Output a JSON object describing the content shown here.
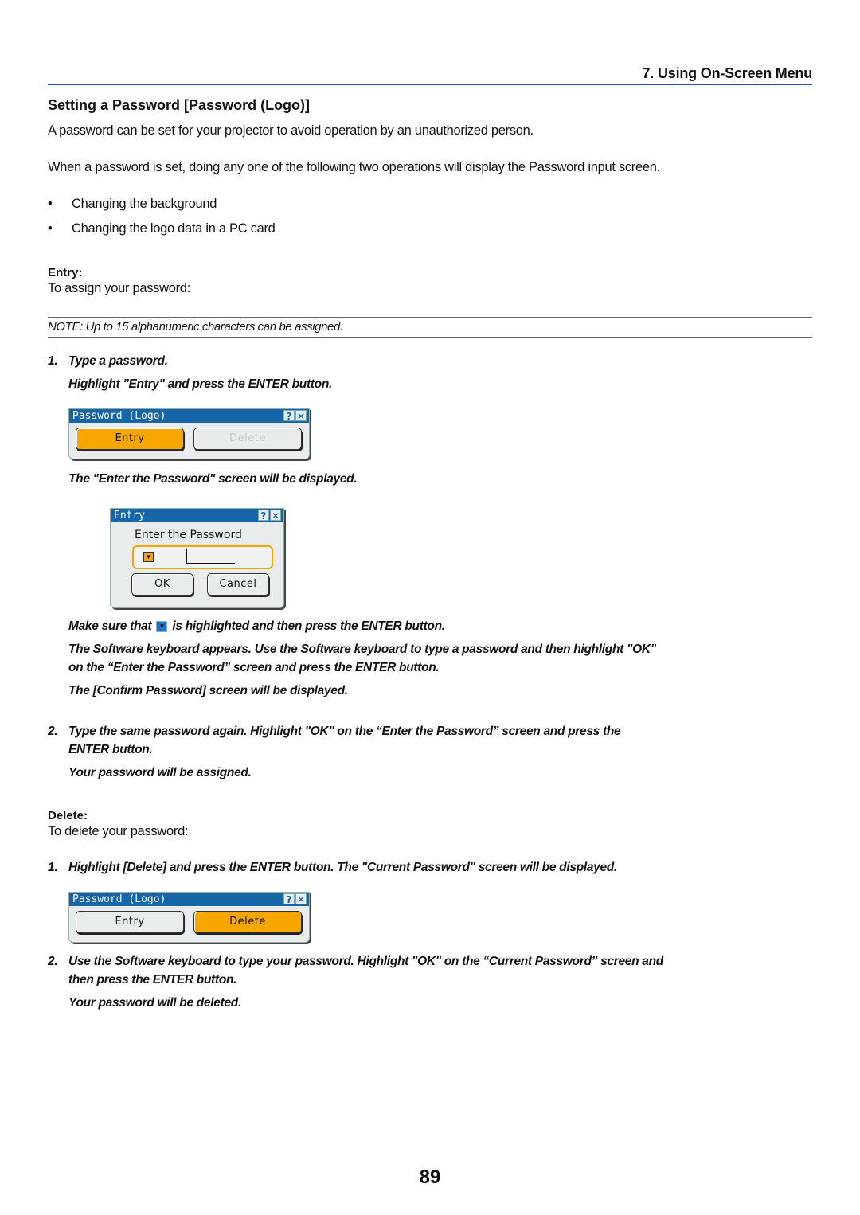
{
  "header": {
    "chapter": "7. Using On-Screen Menu",
    "section_title": "Setting a Password [Password (Logo)]"
  },
  "intro": {
    "para1": "A password can be set for your projector to avoid operation by an unauthorized person.",
    "para2": "When a password is set, doing any one of the following two operations will display the Password input screen.",
    "bullets": [
      "Changing the background",
      "Changing the logo data in a PC card"
    ],
    "bullet_glyph": "•"
  },
  "entry": {
    "label": "Entry:",
    "desc": "To assign your password:",
    "note": "NOTE: Up to 15 alphanumeric characters can be assigned.",
    "step1_num": "1.",
    "step1_title": "Type a password.",
    "step1_line2": "Highlight \"Entry\" and press the ENTER button.",
    "after_osd1": "The \"Enter the Password\" screen will be displayed.",
    "make_sure_pre": "Make sure that",
    "make_sure_post": "is highlighted and then press the ENTER button.",
    "software_kb": "The Software keyboard appears. Use the Software keyboard to type a password and then highlight \"OK\"",
    "software_kb2": "on the “Enter the Password” screen and press the ENTER button.",
    "confirm": "The [Confirm Password] screen will be displayed.",
    "step2_num": "2.",
    "step2_line1": "Type the same password again. Highlight \"OK\" on the “Enter the Password” screen and press the",
    "step2_line2": "ENTER button.",
    "assigned": "Your password will be assigned."
  },
  "delete": {
    "label": "Delete:",
    "desc": "To delete your password:",
    "step1_num": "1.",
    "step1": "Highlight [Delete] and press the ENTER button. The \"Current Password\" screen will be displayed.",
    "step2_num": "2.",
    "step2_line1": "Use the Software keyboard to type your password. Highlight \"OK\" on the “Current Password” screen and",
    "step2_line2": "then press the ENTER button.",
    "deleted": "Your password will be deleted."
  },
  "osd_password_logo_1": {
    "title": "Password (Logo)",
    "help_icon": "?",
    "close_icon": "✕",
    "entry_btn": "Entry",
    "delete_btn": "Delete",
    "highlighted": "Entry"
  },
  "osd_entry": {
    "title": "Entry",
    "help_icon": "?",
    "close_icon": "✕",
    "prompt": "Enter the Password",
    "dropdown_glyph": "▼",
    "field_value": "",
    "ok_btn": "OK",
    "cancel_btn": "Cancel"
  },
  "osd_password_logo_2": {
    "title": "Password (Logo)",
    "help_icon": "?",
    "close_icon": "✕",
    "entry_btn": "Entry",
    "delete_btn": "Delete",
    "highlighted": "Delete"
  },
  "inline_icon_glyph": "▼",
  "page_number": "89",
  "colors": {
    "accent_blue": "#1f4fd8",
    "osd_title_bar": "#1566a8",
    "osd_highlight": "#f7a600"
  }
}
